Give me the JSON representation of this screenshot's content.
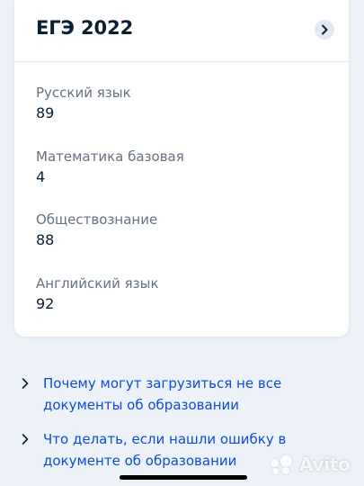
{
  "colors": {
    "background": "#edf2f8",
    "card": "#ffffff",
    "title_text": "#0b1f33",
    "label_text": "#66727f",
    "link_text": "#0d4cd3",
    "expand_button_bg": "#e2e9f2"
  },
  "card": {
    "title": "ЕГЭ 2022",
    "expand_icon": "chevron-right-icon",
    "results": [
      {
        "subject": "Русский язык",
        "score": "89"
      },
      {
        "subject": "Математика базовая",
        "score": "4"
      },
      {
        "subject": "Обществознание",
        "score": "88"
      },
      {
        "subject": "Английский язык",
        "score": "92"
      }
    ]
  },
  "links": [
    {
      "icon": "chevron-right-icon",
      "text": "Почему могут загрузиться не все документы об образовании"
    },
    {
      "icon": "chevron-right-icon",
      "text": "Что делать, если нашли ошибку в документе об образовании"
    }
  ],
  "watermark": {
    "text": "Avito"
  }
}
